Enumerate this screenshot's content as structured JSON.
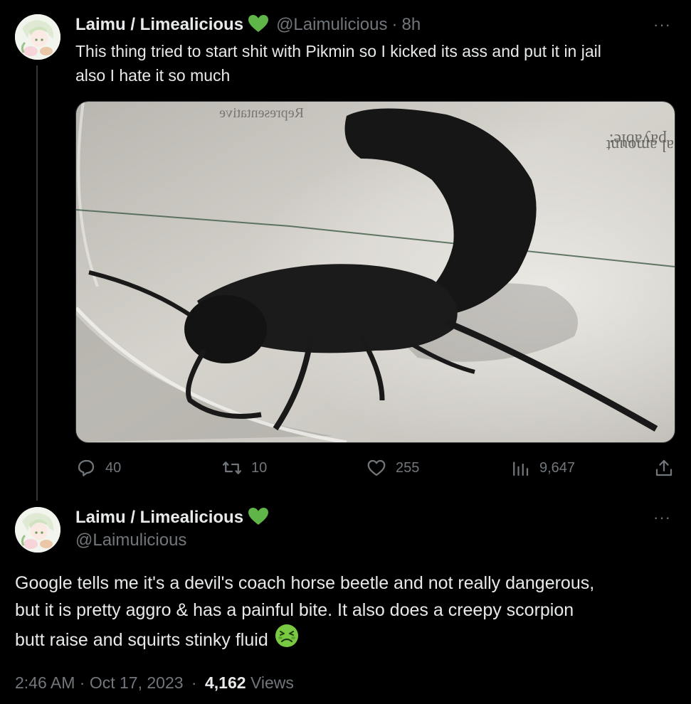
{
  "tweet1": {
    "display_name": "Laimu / Limealicious",
    "handle": "@Laimulicious",
    "separator": "·",
    "time": "8h",
    "text_line1": "This thing tried to start shit with Pikmin so I kicked its ass and put it in jail",
    "text_line2": "also I hate it so much",
    "actions": {
      "reply_count": "40",
      "retweet_count": "10",
      "like_count": "255",
      "view_count": "9,647"
    }
  },
  "tweet2": {
    "display_name": "Laimu / Limealicious",
    "handle": "@Laimulicious",
    "text_line1": "Google tells me it's a devil's coach horse beetle and not really dangerous,",
    "text_line2": "but it is pretty aggro & has a painful bite. It also does a creepy scorpion",
    "text_line3": "butt raise and squirts stinky fluid",
    "timestamp": "2:46 AM · Oct 17, 2023",
    "footer_sep": "·",
    "views_count": "4,162",
    "views_label": "Views"
  },
  "more_label": "···",
  "colors": {
    "verified_heart": "#5fb548",
    "muted": "#71767b",
    "text": "#e7e9ea",
    "sick_emoji": "#7ac943"
  }
}
